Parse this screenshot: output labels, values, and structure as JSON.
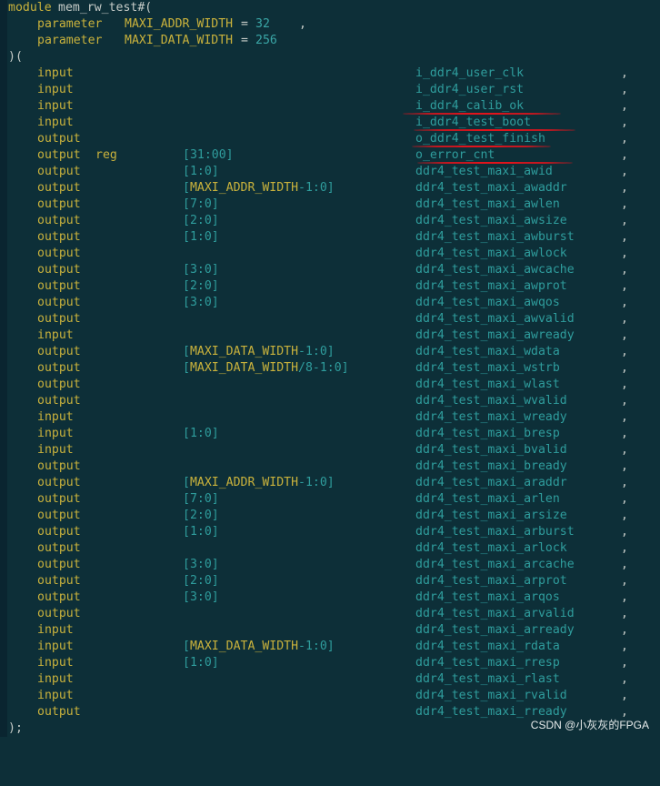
{
  "header": {
    "module_kw": "module",
    "module_name": "mem_rw_test#(",
    "params": [
      {
        "kw": "parameter",
        "name": "MAXI_ADDR_WIDTH",
        "eq": "=",
        "value": "32",
        "tail": ","
      },
      {
        "kw": "parameter",
        "name": "MAXI_DATA_WIDTH",
        "eq": "=",
        "value": "256",
        "tail": ""
      }
    ],
    "open_paren": ")("
  },
  "ports": [
    {
      "dir": "input",
      "type": "",
      "width": "",
      "signal": "i_ddr4_user_clk"
    },
    {
      "dir": "input",
      "type": "",
      "width": "",
      "signal": "i_ddr4_user_rst"
    },
    {
      "dir": "input",
      "type": "",
      "width": "",
      "signal": "i_ddr4_calib_ok"
    },
    {
      "dir": "input",
      "type": "",
      "width": "",
      "signal": "i_ddr4_test_boot"
    },
    {
      "dir": "output",
      "type": "",
      "width": "",
      "signal": "o_ddr4_test_finish"
    },
    {
      "dir": "output",
      "type": "reg",
      "width": "[31:00]",
      "signal": "o_error_cnt"
    },
    {
      "dir": "output",
      "type": "",
      "width": "[1:0]",
      "signal": "ddr4_test_maxi_awid"
    },
    {
      "dir": "output",
      "type": "",
      "width": "[MAXI_ADDR_WIDTH-1:0]",
      "signal": "ddr4_test_maxi_awaddr"
    },
    {
      "dir": "output",
      "type": "",
      "width": "[7:0]",
      "signal": "ddr4_test_maxi_awlen"
    },
    {
      "dir": "output",
      "type": "",
      "width": "[2:0]",
      "signal": "ddr4_test_maxi_awsize"
    },
    {
      "dir": "output",
      "type": "",
      "width": "[1:0]",
      "signal": "ddr4_test_maxi_awburst"
    },
    {
      "dir": "output",
      "type": "",
      "width": "",
      "signal": "ddr4_test_maxi_awlock"
    },
    {
      "dir": "output",
      "type": "",
      "width": "[3:0]",
      "signal": "ddr4_test_maxi_awcache"
    },
    {
      "dir": "output",
      "type": "",
      "width": "[2:0]",
      "signal": "ddr4_test_maxi_awprot"
    },
    {
      "dir": "output",
      "type": "",
      "width": "[3:0]",
      "signal": "ddr4_test_maxi_awqos"
    },
    {
      "dir": "output",
      "type": "",
      "width": "",
      "signal": "ddr4_test_maxi_awvalid"
    },
    {
      "dir": "input",
      "type": "",
      "width": "",
      "signal": "ddr4_test_maxi_awready"
    },
    {
      "dir": "output",
      "type": "",
      "width": "[MAXI_DATA_WIDTH-1:0]",
      "signal": "ddr4_test_maxi_wdata"
    },
    {
      "dir": "output",
      "type": "",
      "width": "[MAXI_DATA_WIDTH/8-1:0]",
      "signal": "ddr4_test_maxi_wstrb"
    },
    {
      "dir": "output",
      "type": "",
      "width": "",
      "signal": "ddr4_test_maxi_wlast"
    },
    {
      "dir": "output",
      "type": "",
      "width": "",
      "signal": "ddr4_test_maxi_wvalid"
    },
    {
      "dir": "input",
      "type": "",
      "width": "",
      "signal": "ddr4_test_maxi_wready"
    },
    {
      "dir": "input",
      "type": "",
      "width": "[1:0]",
      "signal": "ddr4_test_maxi_bresp"
    },
    {
      "dir": "input",
      "type": "",
      "width": "",
      "signal": "ddr4_test_maxi_bvalid"
    },
    {
      "dir": "output",
      "type": "",
      "width": "",
      "signal": "ddr4_test_maxi_bready"
    },
    {
      "dir": "output",
      "type": "",
      "width": "[MAXI_ADDR_WIDTH-1:0]",
      "signal": "ddr4_test_maxi_araddr"
    },
    {
      "dir": "output",
      "type": "",
      "width": "[7:0]",
      "signal": "ddr4_test_maxi_arlen"
    },
    {
      "dir": "output",
      "type": "",
      "width": "[2:0]",
      "signal": "ddr4_test_maxi_arsize"
    },
    {
      "dir": "output",
      "type": "",
      "width": "[1:0]",
      "signal": "ddr4_test_maxi_arburst"
    },
    {
      "dir": "output",
      "type": "",
      "width": "",
      "signal": "ddr4_test_maxi_arlock"
    },
    {
      "dir": "output",
      "type": "",
      "width": "[3:0]",
      "signal": "ddr4_test_maxi_arcache"
    },
    {
      "dir": "output",
      "type": "",
      "width": "[2:0]",
      "signal": "ddr4_test_maxi_arprot"
    },
    {
      "dir": "output",
      "type": "",
      "width": "[3:0]",
      "signal": "ddr4_test_maxi_arqos"
    },
    {
      "dir": "output",
      "type": "",
      "width": "",
      "signal": "ddr4_test_maxi_arvalid"
    },
    {
      "dir": "input",
      "type": "",
      "width": "",
      "signal": "ddr4_test_maxi_arready"
    },
    {
      "dir": "input",
      "type": "",
      "width": "[MAXI_DATA_WIDTH-1:0]",
      "signal": "ddr4_test_maxi_rdata"
    },
    {
      "dir": "input",
      "type": "",
      "width": "[1:0]",
      "signal": "ddr4_test_maxi_rresp"
    },
    {
      "dir": "input",
      "type": "",
      "width": "",
      "signal": "ddr4_test_maxi_rlast"
    },
    {
      "dir": "input",
      "type": "",
      "width": "",
      "signal": "ddr4_test_maxi_rvalid"
    },
    {
      "dir": "output",
      "type": "",
      "width": "",
      "signal": "ddr4_test_maxi_rready"
    }
  ],
  "port_separator": ",",
  "footer": ");",
  "watermark": "CSDN @小灰灰的FPGA",
  "annotation_color": "#e0141c",
  "underlined_ports": [
    2,
    3,
    4,
    5
  ]
}
